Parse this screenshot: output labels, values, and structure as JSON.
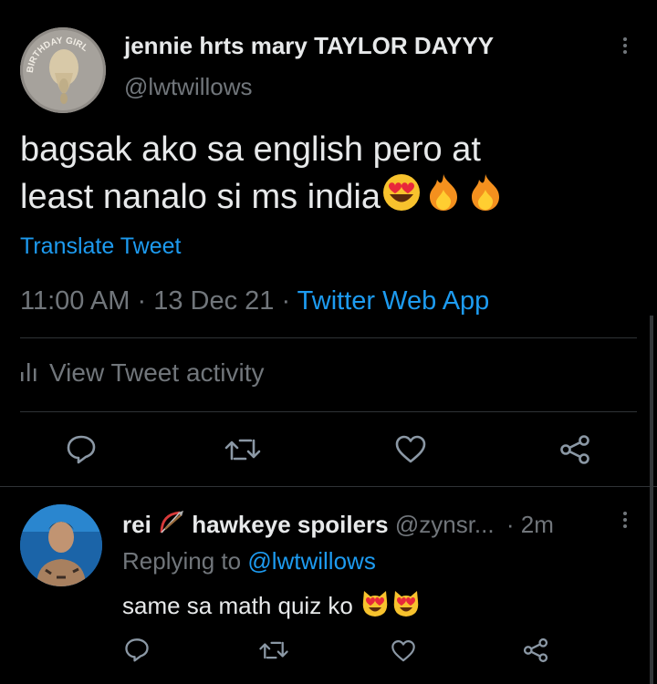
{
  "tweet": {
    "display_name": "jennie hrts mary TAYLOR DAYYY",
    "handle": "@lwtwillows",
    "avatar_text": "BIRTHDAY GIRL",
    "text_line1": "bagsak ako sa english pero at",
    "text_line2": "least nanalo si ms india",
    "translate_label": "Translate Tweet",
    "time": "11:00 AM",
    "separator": "·",
    "date": "13 Dec 21",
    "source": "Twitter Web App",
    "activity_label": "View Tweet activity",
    "emojis": [
      "heart-eyes-emoji",
      "fire-emoji",
      "fire-emoji"
    ]
  },
  "reply": {
    "display_name": "rei",
    "display_name_suffix": "hawkeye spoilers",
    "handle": "@zynsr...",
    "separator": "·",
    "time": "2m",
    "replying_prefix": "Replying to",
    "replying_handle": "@lwtwillows",
    "text": "same sa math quiz ko",
    "emojis": [
      "heart-eyes-cat-emoji",
      "heart-eyes-cat-emoji"
    ]
  },
  "colors": {
    "background": "#000000",
    "text": "#e7e9ea",
    "muted": "#71767b",
    "accent": "#1d9bf0",
    "divider": "#2f3336"
  }
}
